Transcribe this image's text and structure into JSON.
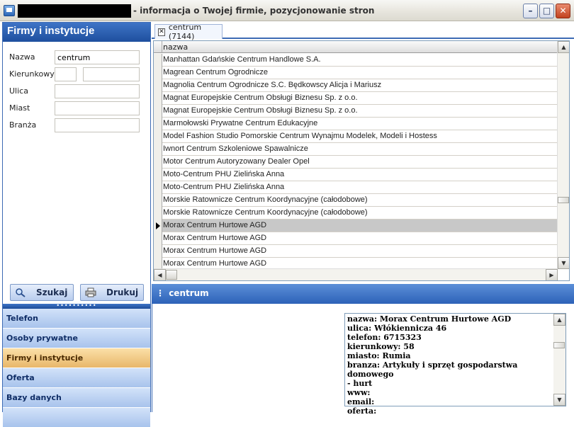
{
  "window": {
    "title": "- informacja o Twojej firmie, pozycjonowanie stron",
    "min_label": "–",
    "max_label": "□",
    "close_label": "✕"
  },
  "left": {
    "header": "Firmy i instytucje",
    "fields": {
      "nazwa_label": "Nazwa",
      "nazwa_value": "centrum",
      "kierunkowy_label": "Kierunkowy",
      "ulica_label": "Ulica",
      "miast_label": "Miast",
      "branza_label": "Branża"
    },
    "search_button": "Szukaj",
    "print_button": "Drukuj",
    "splitter": "••••••••••"
  },
  "nav": {
    "items": [
      {
        "label": "Telefon"
      },
      {
        "label": "Osoby prywatne"
      },
      {
        "label": "Firmy i instytucje"
      },
      {
        "label": "Oferta"
      },
      {
        "label": "Bazy danych"
      }
    ]
  },
  "tab": {
    "label": "centrum (7144)",
    "close": "✕"
  },
  "grid": {
    "column": "nazwa",
    "rows": [
      "Manhattan Gdańskie Centrum Handlowe S.A.",
      "Magrean Centrum Ogrodnicze",
      "Magnolia Centrum Ogrodnicze S.C. Będkowscy Alicja i Mariusz",
      "Magnat Europejskie Centrum Obsługi Biznesu  Sp. z o.o.",
      "Magnat Europejskie Centrum Obsługi Biznesu  Sp. z o.o.",
      "Marmołowski Prywatne Centrum Edukacyjne",
      "Model Fashion Studio Pomorskie Centrum Wynajmu Modelek, Modeli i Hostess",
      "Iwnort Centrum Szkoleniowe Spawalnicze",
      "Motor Centrum Autoryzowany Dealer Opel",
      "Moto-Centrum PHU Zielińska Anna",
      "Moto-Centrum PHU Zielińska Anna",
      "Morskie Ratownicze Centrum Koordynacyjne (całodobowe)",
      "Morskie Ratownicze Centrum Koordynacyjne (całodobowe)",
      "Morax Centrum Hurtowe AGD",
      "Morax Centrum Hurtowe AGD",
      "Morax Centrum Hurtowe AGD",
      "Morax Centrum Hurtowe AGD"
    ],
    "selected_index": 13,
    "up": "▲",
    "down": "▼",
    "left": "◀",
    "right": "▶"
  },
  "detail": {
    "title": "centrum",
    "grip": "⋮",
    "lines": [
      "nazwa: Morax Centrum Hurtowe AGD",
      "ulica: Włókiennicza 46",
      "telefon: 6715323",
      "kierunkowy: 58",
      "miasto: Rumia",
      "branza: Artykuły i sprzęt gospodarstwa domowego",
      "- hurt",
      "www:",
      "email:",
      "oferta:"
    ]
  },
  "colors": {
    "accent": "#2d62b8",
    "active_nav": "#e8b76a",
    "selected_row": "#c8c8c8"
  }
}
